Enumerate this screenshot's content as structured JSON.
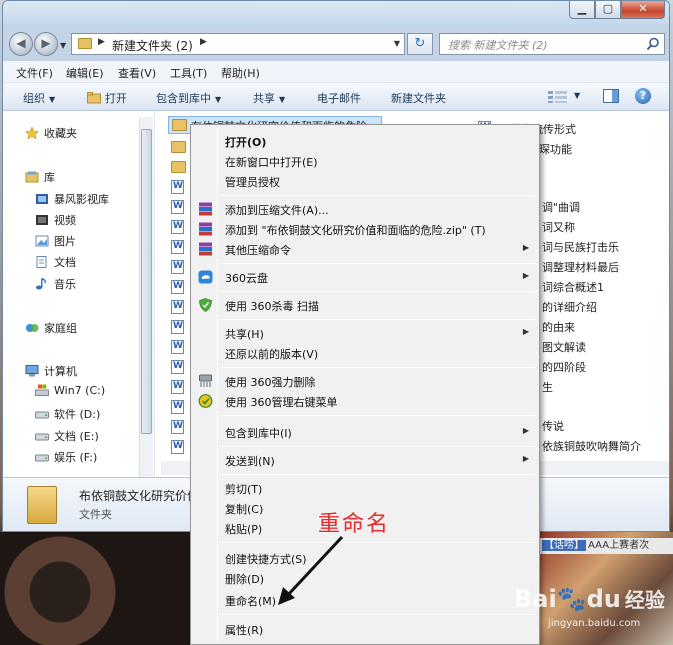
{
  "window": {
    "address": {
      "folder_name": "新建文件夹 (2)"
    },
    "search_placeholder": "搜索 新建文件夹 (2)"
  },
  "menubar": [
    "文件(F)",
    "编辑(E)",
    "查看(V)",
    "工具(T)",
    "帮助(H)"
  ],
  "toolbar": {
    "organize": "组织",
    "open": "打开",
    "include_library": "包含到库中",
    "share": "共享",
    "email": "电子邮件",
    "new_folder": "新建文件夹"
  },
  "navpane": {
    "favorites": "收藏夹",
    "libraries": "库",
    "lib_items": [
      "暴风影视库",
      "视频",
      "图片",
      "文档",
      "音乐"
    ],
    "homegroup": "家庭组",
    "computer": "计算机",
    "drives": [
      "Win7 (C:)",
      "软件 (D:)",
      "文档 (E:)",
      "娱乐 (F:)"
    ]
  },
  "files": {
    "selected": "布依铜鼓文化研究价值和面临的危险",
    "right_column": [
      "铜鼓的流传形式",
      "琛功能",
      "调\"曲调",
      "词又称",
      "词与民族打击乐",
      "调整理材料最后",
      "词综合概述1",
      "的详细介绍",
      "的由来",
      "图文解读",
      "的四阶段",
      "生",
      "传说",
      "依族铜鼓吹呐舞简介"
    ]
  },
  "details": {
    "name": "布依铜鼓文化研究价值",
    "type": "文件夹"
  },
  "context_menu": {
    "items": [
      {
        "label": "打开(O)",
        "bold": true
      },
      {
        "label": "在新窗口中打开(E)"
      },
      {
        "label": "管理员授权"
      },
      {
        "label": "添加到压缩文件(A)...",
        "icon": "winrar-icon"
      },
      {
        "label": "添加到 \"布依铜鼓文化研究价值和面临的危险.zip\" (T)",
        "icon": "winrar-icon"
      },
      {
        "label": "其他压缩命令",
        "icon": "winrar-icon",
        "submenu": true
      },
      {
        "label": "360云盘",
        "icon": "cloud-icon",
        "submenu": true
      },
      {
        "label": "使用 360杀毒 扫描",
        "icon": "shield-icon"
      },
      {
        "label": "共享(H)",
        "submenu": true
      },
      {
        "label": "还原以前的版本(V)"
      },
      {
        "label": "使用 360强力删除",
        "icon": "shredder-icon"
      },
      {
        "label": "使用 360管理右键菜单",
        "icon": "manager-icon"
      },
      {
        "label": "包含到库中(I)",
        "submenu": true
      },
      {
        "label": "发送到(N)",
        "submenu": true
      },
      {
        "label": "剪切(T)"
      },
      {
        "label": "复制(C)"
      },
      {
        "label": "粘贴(P)"
      },
      {
        "label": "创建快捷方式(S)"
      },
      {
        "label": "删除(D)"
      },
      {
        "label": "重命名(M)"
      },
      {
        "label": "属性(R)"
      }
    ]
  },
  "annotation": {
    "text": "重命名",
    "color": "#e52c2c"
  },
  "desktop": {
    "news": "AAA上赛者次",
    "news_tag": "【话唠】"
  },
  "watermark": {
    "brand": "Bai",
    "paw": "du",
    "text": "经验",
    "url": "jingyan.baidu.com"
  }
}
